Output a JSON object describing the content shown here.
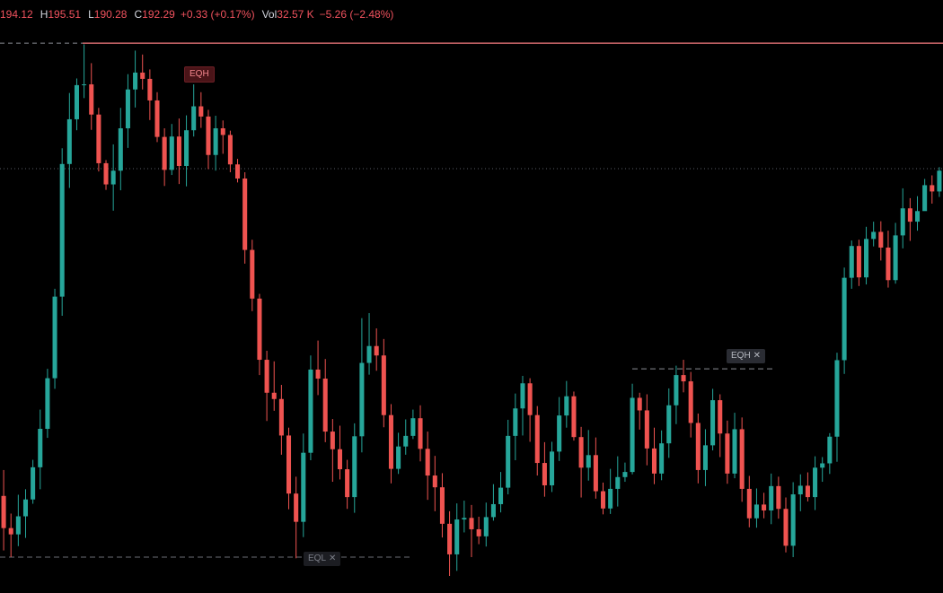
{
  "header": {
    "open_value": "194.12",
    "high_label": "H",
    "high_value": "195.51",
    "low_label": "L",
    "low_value": "190.28",
    "close_label": "C",
    "close_value": "192.29",
    "change": "+0.33 (+0.17%)",
    "vol_label": "Vol",
    "vol_value": "32.57 K",
    "vol_change": "−5.26 (−2.48%)"
  },
  "colors": {
    "background": "#000000",
    "up": "#26a69a",
    "down": "#ef5350",
    "eqh_line": "#f77c80",
    "eql_line": "#6b6e76",
    "dotted": "#5a5d66",
    "text_red": "#f0525e"
  },
  "levels": {
    "eqh_top": {
      "label": "EQH",
      "price": 195.5
    },
    "eqh_mid": {
      "label": "EQH",
      "price": 187.2,
      "close": "✕"
    },
    "eql": {
      "label": "EQL",
      "price": 182.4,
      "close": "✕"
    },
    "dotted_ref": {
      "price": 192.3
    }
  },
  "chart_data": {
    "type": "candlestick",
    "title": "",
    "xlabel": "",
    "ylabel": "",
    "ylim": [
      181.6,
      196.6
    ],
    "candles": [
      [
        183.96,
        183.14,
        184.62,
        182.57
      ],
      [
        183.14,
        182.98,
        183.51,
        182.4
      ],
      [
        182.98,
        183.44,
        183.99,
        182.68
      ],
      [
        183.44,
        183.87,
        184.13,
        182.89
      ],
      [
        183.87,
        184.69,
        184.88,
        183.76
      ],
      [
        184.69,
        185.67,
        186.16,
        184.13
      ],
      [
        185.67,
        186.96,
        187.2,
        185.44
      ],
      [
        186.96,
        189.04,
        189.24,
        186.69
      ],
      [
        189.04,
        192.42,
        192.82,
        188.55
      ],
      [
        192.42,
        193.56,
        194.23,
        191.81
      ],
      [
        193.56,
        194.43,
        194.6,
        193.28
      ],
      [
        194.43,
        194.45,
        195.47,
        194.1
      ],
      [
        194.45,
        193.68,
        194.99,
        193.29
      ],
      [
        193.68,
        192.44,
        193.85,
        192.23
      ],
      [
        192.44,
        191.9,
        192.52,
        191.76
      ],
      [
        191.9,
        192.25,
        192.92,
        191.23
      ],
      [
        192.25,
        193.33,
        193.85,
        191.75
      ],
      [
        193.33,
        194.32,
        194.71,
        192.83
      ],
      [
        194.32,
        194.75,
        195.31,
        193.86
      ],
      [
        194.75,
        194.59,
        195.21,
        194.32
      ],
      [
        194.59,
        194.04,
        194.83,
        193.54
      ],
      [
        194.04,
        193.11,
        194.25,
        192.98
      ],
      [
        193.11,
        192.27,
        193.33,
        191.86
      ],
      [
        192.27,
        193.12,
        193.44,
        192.14
      ],
      [
        193.12,
        192.37,
        193.58,
        191.91
      ],
      [
        192.37,
        193.28,
        193.66,
        191.85
      ],
      [
        193.28,
        193.89,
        194.45,
        193.12
      ],
      [
        193.89,
        193.63,
        194.25,
        193.34
      ],
      [
        193.63,
        192.65,
        193.8,
        192.29
      ],
      [
        192.65,
        193.33,
        193.65,
        192.25
      ],
      [
        193.33,
        193.16,
        193.53,
        192.68
      ],
      [
        193.16,
        192.41,
        193.27,
        192.21
      ],
      [
        192.41,
        192.05,
        192.55,
        191.95
      ],
      [
        192.05,
        190.23,
        192.21,
        189.88
      ],
      [
        190.23,
        188.99,
        190.49,
        188.67
      ],
      [
        188.99,
        187.43,
        189.11,
        187.04
      ],
      [
        187.43,
        186.59,
        187.66,
        185.87
      ],
      [
        186.59,
        186.43,
        187.39,
        186.13
      ],
      [
        186.43,
        185.5,
        186.79,
        185.01
      ],
      [
        185.5,
        184.02,
        185.7,
        183.62
      ],
      [
        184.02,
        183.3,
        184.45,
        182.37
      ],
      [
        183.3,
        185.06,
        185.55,
        182.91
      ],
      [
        185.06,
        187.18,
        187.54,
        184.87
      ],
      [
        187.18,
        186.95,
        187.92,
        186.53
      ],
      [
        186.95,
        185.6,
        187.45,
        185.33
      ],
      [
        185.6,
        185.15,
        185.92,
        184.32
      ],
      [
        185.15,
        184.64,
        185.75,
        184.38
      ],
      [
        184.64,
        183.93,
        184.88,
        183.63
      ],
      [
        183.93,
        185.48,
        185.81,
        183.53
      ],
      [
        185.48,
        187.35,
        188.49,
        185.07
      ],
      [
        187.35,
        187.78,
        188.62,
        187.05
      ],
      [
        187.78,
        187.54,
        188.23,
        187.15
      ],
      [
        187.54,
        186.02,
        187.96,
        185.71
      ],
      [
        186.02,
        184.65,
        186.3,
        184.28
      ],
      [
        184.65,
        185.22,
        185.57,
        184.52
      ],
      [
        185.22,
        185.49,
        185.91,
        185.01
      ],
      [
        185.49,
        185.94,
        186.16,
        185.41
      ],
      [
        185.94,
        185.16,
        186.27,
        184.84
      ],
      [
        185.16,
        184.48,
        185.6,
        183.86
      ],
      [
        184.48,
        184.18,
        184.98,
        183.57
      ],
      [
        184.18,
        183.25,
        184.54,
        182.9
      ],
      [
        183.25,
        182.47,
        183.57,
        181.92
      ],
      [
        182.47,
        183.36,
        183.77,
        182.05
      ],
      [
        183.36,
        183.4,
        183.84,
        183.03
      ],
      [
        183.4,
        183.11,
        183.73,
        182.4
      ],
      [
        183.11,
        182.93,
        183.43,
        182.73
      ],
      [
        182.93,
        183.42,
        183.79,
        182.67
      ],
      [
        183.42,
        183.75,
        184.26,
        183.33
      ],
      [
        183.75,
        184.17,
        184.57,
        183.54
      ],
      [
        184.17,
        185.49,
        185.9,
        184.0
      ],
      [
        185.49,
        186.19,
        186.57,
        184.87
      ],
      [
        186.19,
        186.83,
        187.02,
        185.5
      ],
      [
        186.83,
        186.02,
        186.96,
        185.34
      ],
      [
        186.02,
        184.8,
        186.25,
        184.48
      ],
      [
        184.8,
        184.23,
        185.33,
        183.94
      ],
      [
        184.23,
        185.09,
        185.34,
        184.06
      ],
      [
        185.09,
        186.01,
        186.48,
        184.85
      ],
      [
        186.01,
        186.5,
        186.89,
        185.7
      ],
      [
        186.5,
        185.46,
        186.62,
        185.37
      ],
      [
        185.46,
        184.68,
        185.72,
        183.92
      ],
      [
        184.68,
        185.0,
        185.64,
        184.35
      ],
      [
        185.0,
        184.08,
        185.45,
        183.89
      ],
      [
        184.08,
        183.64,
        184.3,
        183.49
      ],
      [
        183.64,
        184.14,
        184.65,
        183.5
      ],
      [
        184.14,
        184.44,
        184.97,
        183.69
      ],
      [
        184.44,
        184.57,
        184.81,
        184.32
      ],
      [
        184.57,
        186.46,
        186.82,
        184.51
      ],
      [
        186.46,
        186.14,
        186.59,
        185.65
      ],
      [
        186.14,
        185.17,
        186.55,
        184.74
      ],
      [
        185.17,
        184.53,
        185.7,
        184.26
      ],
      [
        184.53,
        185.3,
        185.63,
        184.36
      ],
      [
        185.3,
        186.27,
        186.7,
        184.93
      ],
      [
        186.27,
        187.04,
        187.28,
        185.79
      ],
      [
        187.04,
        186.88,
        187.43,
        186.6
      ],
      [
        186.88,
        185.82,
        187.12,
        185.45
      ],
      [
        185.82,
        184.62,
        186.06,
        184.28
      ],
      [
        184.62,
        185.25,
        185.66,
        184.21
      ],
      [
        185.25,
        186.4,
        186.69,
        185.12
      ],
      [
        186.4,
        185.55,
        186.55,
        184.95
      ],
      [
        185.55,
        184.53,
        185.88,
        184.27
      ],
      [
        184.53,
        185.66,
        186.08,
        184.41
      ],
      [
        185.66,
        184.14,
        185.96,
        183.81
      ],
      [
        184.14,
        183.39,
        184.47,
        183.16
      ],
      [
        183.39,
        183.74,
        184.15,
        183.15
      ],
      [
        183.74,
        183.59,
        184.04,
        183.39
      ],
      [
        183.59,
        184.21,
        184.53,
        183.24
      ],
      [
        184.21,
        183.63,
        184.45,
        183.38
      ],
      [
        183.63,
        182.69,
        183.92,
        182.52
      ],
      [
        182.69,
        184.0,
        184.31,
        182.4
      ],
      [
        184.0,
        184.22,
        184.51,
        183.57
      ],
      [
        184.22,
        183.93,
        184.56,
        183.82
      ],
      [
        183.93,
        184.68,
        184.97,
        183.6
      ],
      [
        184.68,
        184.79,
        184.95,
        184.32
      ],
      [
        184.79,
        185.47,
        185.56,
        184.52
      ],
      [
        185.47,
        187.42,
        187.61,
        184.83
      ],
      [
        187.42,
        189.52,
        189.78,
        187.07
      ],
      [
        189.52,
        190.33,
        190.47,
        189.24
      ],
      [
        190.33,
        189.53,
        190.49,
        189.31
      ],
      [
        189.53,
        190.51,
        190.82,
        189.35
      ],
      [
        190.51,
        190.69,
        190.95,
        190.32
      ],
      [
        190.69,
        190.29,
        190.96,
        189.96
      ],
      [
        190.29,
        189.46,
        190.72,
        189.27
      ],
      [
        189.46,
        190.6,
        190.92,
        189.37
      ],
      [
        190.6,
        191.29,
        191.8,
        190.27
      ],
      [
        191.29,
        190.95,
        191.55,
        190.46
      ],
      [
        190.95,
        191.22,
        191.6,
        190.72
      ],
      [
        191.22,
        191.88,
        192.04,
        191.55
      ],
      [
        191.88,
        191.72,
        192.13,
        191.41
      ],
      [
        191.72,
        192.25,
        192.34,
        191.58
      ]
    ]
  }
}
